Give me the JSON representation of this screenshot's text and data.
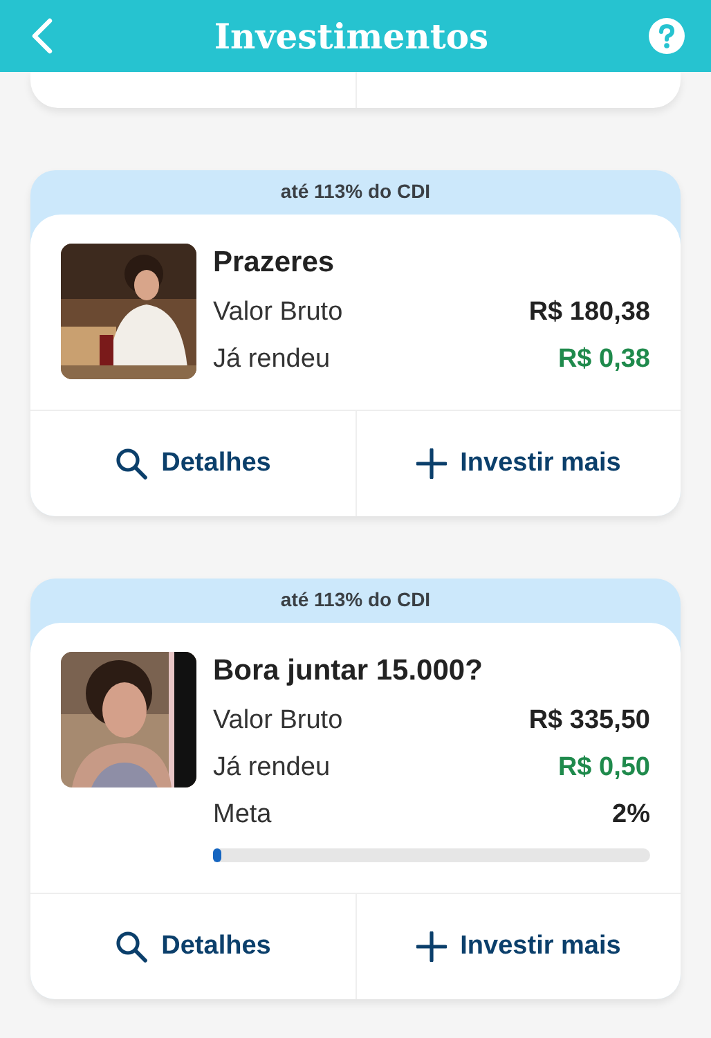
{
  "header": {
    "title": "Investimentos"
  },
  "investments": [
    {
      "badge": "até 113% do CDI",
      "title": "Prazeres",
      "rows": [
        {
          "label": "Valor Bruto",
          "value": "R$ 180,38",
          "kind": "plain"
        },
        {
          "label": "Já rendeu",
          "value": "R$ 0,38",
          "kind": "gain"
        }
      ],
      "actions": [
        {
          "label": "Detalhes",
          "kind": "details"
        },
        {
          "label": "Investir mais",
          "kind": "invest"
        }
      ]
    },
    {
      "badge": "até 113% do CDI",
      "title": "Bora juntar 15.000?",
      "rows": [
        {
          "label": "Valor Bruto",
          "value": "R$ 335,50",
          "kind": "plain"
        },
        {
          "label": "Já rendeu",
          "value": "R$ 0,50",
          "kind": "gain"
        }
      ],
      "goal": {
        "label": "Meta",
        "value": "2%",
        "level": 0.02
      },
      "actions": [
        {
          "label": "Detalhes",
          "kind": "details"
        },
        {
          "label": "Investir mais",
          "kind": "invest"
        }
      ]
    }
  ]
}
